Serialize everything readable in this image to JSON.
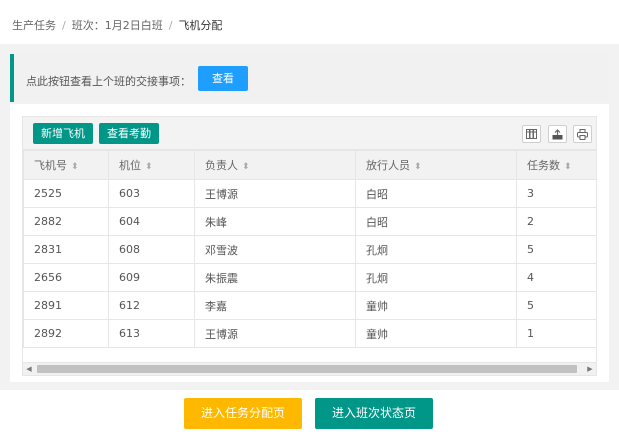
{
  "breadcrumb": {
    "items": [
      "生产任务",
      "班次：1月2日白班",
      "飞机分配"
    ],
    "separator": "/"
  },
  "notice": {
    "text": "点此按钮查看上个班的交接事项：",
    "button_label": "查看"
  },
  "toolbar": {
    "add_aircraft_label": "新增飞机",
    "attendance_label": "查看考勤",
    "icons": [
      "columns-icon",
      "export-icon",
      "print-icon"
    ]
  },
  "table": {
    "columns": [
      "飞机号",
      "机位",
      "负责人",
      "放行人员",
      "任务数"
    ],
    "rows": [
      [
        "2525",
        "603",
        "王博源",
        "白昭",
        "3"
      ],
      [
        "2882",
        "604",
        "朱峰",
        "白昭",
        "2"
      ],
      [
        "2831",
        "608",
        "邓雪波",
        "孔炯",
        "5"
      ],
      [
        "2656",
        "609",
        "朱振震",
        "孔炯",
        "4"
      ],
      [
        "2891",
        "612",
        "李嘉",
        "童帅",
        "5"
      ],
      [
        "2892",
        "613",
        "王博源",
        "童帅",
        "1"
      ]
    ]
  },
  "footer": {
    "task_assign_label": "进入任务分配页",
    "shift_status_label": "进入班次状态页"
  },
  "colors": {
    "accent_teal": "#009688",
    "blue": "#1e9fff",
    "yellow": "#ffb800"
  }
}
